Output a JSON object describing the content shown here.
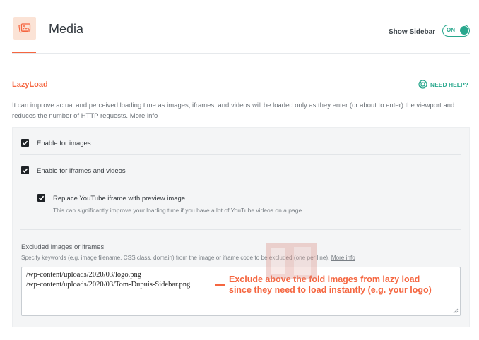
{
  "header": {
    "title": "Media",
    "icon": "media-image-icon",
    "show_sidebar_label": "Show Sidebar",
    "toggle_label": "ON"
  },
  "lazyload": {
    "title": "LazyLoad",
    "help_label": "NEED HELP?",
    "description": "It can improve actual and perceived loading time as images, iframes, and videos will be loaded only as they enter (or about to enter) the viewport and reduces the number of HTTP requests.",
    "more_info": "More info",
    "options": [
      {
        "label": "Enable for images",
        "checked": true
      },
      {
        "label": "Enable for iframes and videos",
        "checked": true
      },
      {
        "label": "Replace YouTube iframe with preview image",
        "checked": true,
        "description": "This can significantly improve your loading time if you have a lot of YouTube videos on a page."
      }
    ],
    "excluded": {
      "title": "Excluded images or iframes",
      "description": "Specify keywords (e.g. image filename, CSS class, domain) from the image or iframe code to be excluded (one per line).",
      "more_info": "More info",
      "lines": [
        "/wp-content/uploads/2020/03/logo.png",
        "/wp-content/uploads/2020/03/Tom-Dupuis-Sidebar.png"
      ]
    }
  },
  "annotation": {
    "line1": "Exclude above the fold images from lazy load",
    "line2": "since they need to load instantly (e.g. your logo)"
  },
  "colors": {
    "accent": "#f56640",
    "toggle": "#28a78d"
  }
}
